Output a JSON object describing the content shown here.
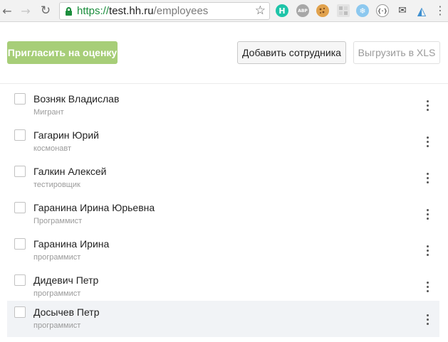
{
  "browser": {
    "url_scheme": "https://",
    "url_host": "test.hh.ru",
    "url_path": "/employees",
    "extensions": {
      "h": "H",
      "abp": "ABP",
      "snow": "❄",
      "code": "{·}",
      "mail": "✉",
      "drop": "◭"
    }
  },
  "toolbar": {
    "invite_label": "Пригласить на оценку",
    "add_employee_label": "Добавить сотрудника",
    "export_label": "Выгрузить в XLS"
  },
  "employees": [
    {
      "name": "Возняк Владислав",
      "role": "Мигрант"
    },
    {
      "name": "Гагарин Юрий",
      "role": "космонавт"
    },
    {
      "name": "Галкин Алексей",
      "role": "тестировщик"
    },
    {
      "name": "Гаранина Ирина Юрьевна",
      "role": "Программист"
    },
    {
      "name": "Гаранина Ирина",
      "role": "программист"
    },
    {
      "name": "Дидевич Петр",
      "role": "программист"
    },
    {
      "name": "Досычев Петр",
      "role": "программист"
    }
  ],
  "colors": {
    "accent_green": "#a7ce78",
    "secure_green": "#1b8e3d",
    "highlight_row": "#f1f3f6"
  }
}
